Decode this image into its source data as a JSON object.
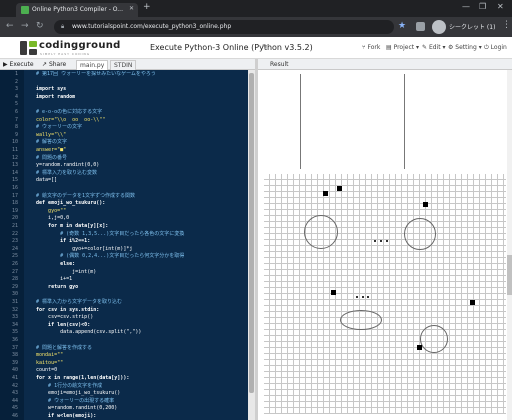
{
  "browser": {
    "tab_title": "Online Python3 Compiler - O...",
    "new_tab": "+",
    "url": "www.tutorialspoint.com/execute_python3_online.php",
    "profile_name": "シークレット (1)",
    "win_min": "—",
    "win_max": "❐",
    "win_close": "✕"
  },
  "site": {
    "logo_text": "codingground",
    "logo_sub": "SIMPLY EASY CODING",
    "page_title": "Execute Python-3 Online (Python v3.5.2)",
    "menu": {
      "fork": "Fork",
      "project": "Project",
      "edit": "Edit",
      "setting": "Setting",
      "login": "Login"
    }
  },
  "editor": {
    "execute_label": "Execute",
    "share_label": "Share",
    "file_tab": "main.py",
    "stdin_tab": "STDIN",
    "lines": [
      {
        "n": "1",
        "t": "  # 第17回 ウォーリーを探せみたいなゲームをやろう",
        "c": "cm"
      },
      {
        "n": "2",
        "t": "",
        "c": ""
      },
      {
        "n": "3",
        "t": "  import sys",
        "c": "kw"
      },
      {
        "n": "4",
        "t": "  import random",
        "c": "kw"
      },
      {
        "n": "5",
        "t": "",
        "c": ""
      },
      {
        "n": "6",
        "t": "  # e-o-oの色に対応する文字",
        "c": "cm"
      },
      {
        "n": "7",
        "t": "  color=\"\\\\o  oo  oo-\\\\\"\"",
        "c": "str"
      },
      {
        "n": "8",
        "t": "  # ウォーリーの文字",
        "c": "cm"
      },
      {
        "n": "9",
        "t": "  wally=\"\\\\\"",
        "c": "str"
      },
      {
        "n": "10",
        "t": "  # 解答の文字",
        "c": "cm"
      },
      {
        "n": "11",
        "t": "  answer=\"■\"",
        "c": "str"
      },
      {
        "n": "12",
        "t": "  # 問題の番号",
        "c": "cm"
      },
      {
        "n": "13",
        "t": "  y=random.randint(0,0)",
        "c": ""
      },
      {
        "n": "14",
        "t": "  # 標準入力を取り込む変数",
        "c": "cm"
      },
      {
        "n": "15",
        "t": "  data=[]",
        "c": ""
      },
      {
        "n": "16",
        "t": "",
        "c": ""
      },
      {
        "n": "17",
        "t": "  # 絵文字のデータを1文字ずつ作成する関数",
        "c": "cm"
      },
      {
        "n": "18",
        "t": "  def emoji_wo_tsukuru():",
        "c": "kw"
      },
      {
        "n": "19",
        "t": "      gyo=\"\"",
        "c": "str"
      },
      {
        "n": "20",
        "t": "      i,j=0,0",
        "c": ""
      },
      {
        "n": "21",
        "t": "      for m in data[y][x]:",
        "c": "kw"
      },
      {
        "n": "22",
        "t": "          # (奇数 1,3,5...)文字目だったら各色の文字に変換",
        "c": "cm"
      },
      {
        "n": "23",
        "t": "          if i%2==1:",
        "c": "kw"
      },
      {
        "n": "24",
        "t": "              gyo+=color[int(m)]*j",
        "c": ""
      },
      {
        "n": "25",
        "t": "          # (偶数 0,2,4...)文字目だったら何文字分かを取得",
        "c": "cm"
      },
      {
        "n": "26",
        "t": "          else:",
        "c": "kw"
      },
      {
        "n": "27",
        "t": "              j=int(m)",
        "c": ""
      },
      {
        "n": "28",
        "t": "          i+=1",
        "c": ""
      },
      {
        "n": "29",
        "t": "      return gyo",
        "c": "kw"
      },
      {
        "n": "30",
        "t": "",
        "c": ""
      },
      {
        "n": "31",
        "t": "  # 標準入力から文字データを取り込む",
        "c": "cm"
      },
      {
        "n": "32",
        "t": "  for csv in sys.stdin:",
        "c": "kw"
      },
      {
        "n": "33",
        "t": "      csv=csv.strip()",
        "c": ""
      },
      {
        "n": "34",
        "t": "      if len(csv)<0:",
        "c": "kw"
      },
      {
        "n": "35",
        "t": "          data.append(csv.split(\",\"))",
        "c": ""
      },
      {
        "n": "36",
        "t": "",
        "c": ""
      },
      {
        "n": "37",
        "t": "  # 問題と解答を作成する",
        "c": "cm"
      },
      {
        "n": "38",
        "t": "  mondai=\"\"",
        "c": "str"
      },
      {
        "n": "39",
        "t": "  kaitou=\"\"",
        "c": "str"
      },
      {
        "n": "40",
        "t": "  count=0",
        "c": ""
      },
      {
        "n": "41",
        "t": "  for x in range(1,len(data[y])):",
        "c": "kw"
      },
      {
        "n": "42",
        "t": "      # 1行分の絵文字を作成",
        "c": "cm"
      },
      {
        "n": "43",
        "t": "      emoji=emoji_wo_tsukuru()",
        "c": ""
      },
      {
        "n": "44",
        "t": "      # ウォーリーの出現する確率",
        "c": "cm"
      },
      {
        "n": "45",
        "t": "      w=random.randint(0,200)",
        "c": ""
      },
      {
        "n": "46",
        "t": "      if w<len(emoji):",
        "c": "kw"
      }
    ]
  },
  "result": {
    "label": "Result"
  }
}
